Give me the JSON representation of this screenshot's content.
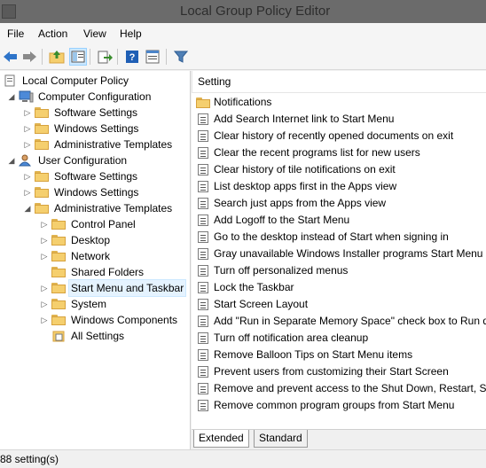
{
  "window": {
    "title": "Local Group Policy Editor"
  },
  "menu": [
    "File",
    "Action",
    "View",
    "Help"
  ],
  "toolbar": {
    "icons": [
      "back-arrow-icon",
      "forward-arrow-icon",
      "up-folder-icon",
      "show-hide-tree-icon",
      "export-list-icon",
      "help-icon",
      "properties-icon",
      "filter-icon"
    ]
  },
  "tree": {
    "root": "Local Computer Policy",
    "computer_config": "Computer Configuration",
    "cc_software": "Software Settings",
    "cc_windows": "Windows Settings",
    "cc_admin": "Administrative Templates",
    "user_config": "User Configuration",
    "uc_software": "Software Settings",
    "uc_windows": "Windows Settings",
    "uc_admin": "Administrative Templates",
    "control_panel": "Control Panel",
    "desktop": "Desktop",
    "network": "Network",
    "shared_folders": "Shared Folders",
    "start_menu": "Start Menu and Taskbar",
    "system": "System",
    "windows_components": "Windows Components",
    "all_settings": "All Settings"
  },
  "list": {
    "column_header": "Setting",
    "rows": [
      "Notifications",
      "Add Search Internet link to Start Menu",
      "Clear history of recently opened documents on exit",
      "Clear the recent programs list for new users",
      "Clear history of tile notifications on exit",
      "List desktop apps first in the Apps view",
      "Search just apps from the Apps view",
      "Add Logoff to the Start Menu",
      "Go to the desktop instead of Start when signing in",
      "Gray unavailable Windows Installer programs Start Menu sh",
      "Turn off personalized menus",
      "Lock the Taskbar",
      "Start Screen Layout",
      "Add \"Run in Separate Memory Space\" check box to Run dia",
      "Turn off notification area cleanup",
      "Remove Balloon Tips on Start Menu items",
      "Prevent users from customizing their Start Screen",
      "Remove and prevent access to the Shut Down, Restart, Slee",
      "Remove common program groups from Start Menu"
    ]
  },
  "tabs": {
    "extended": "Extended",
    "standard": "Standard"
  },
  "status": {
    "text": "88 setting(s)"
  },
  "colors": {
    "selected_bg": "#e5f3ff",
    "titlebar": "#6b6b6b"
  }
}
